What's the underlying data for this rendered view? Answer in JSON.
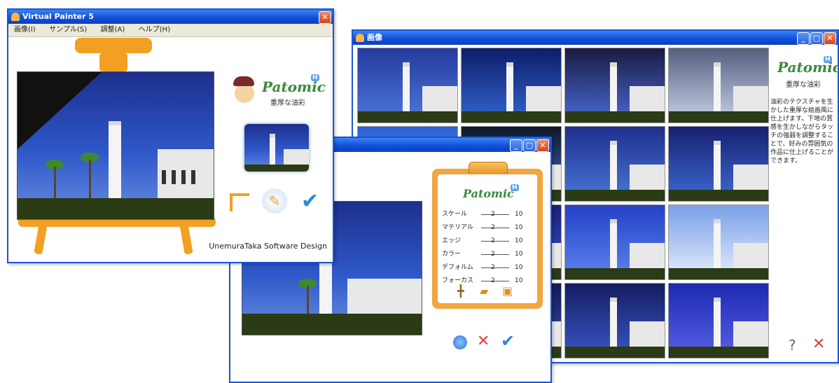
{
  "main_window": {
    "title": "Virtual Painter 5",
    "menu": [
      "画像(I)",
      "サンプル(S)",
      "調整(A)",
      "ヘルプ(H)"
    ],
    "logo_text": "Patomic",
    "logo_badge": "H",
    "logo_subtitle": "重厚な油彩",
    "credit": "UnemuraTaka Software Design"
  },
  "gallery_window": {
    "title": "画像",
    "logo_text": "Patomic",
    "logo_badge": "H",
    "logo_subtitle": "重厚な油彩",
    "description": "油彩のテクスチャを生かした重厚な絵画風に仕上げます。下地の質感を生かしながらタッチの強弱を調整することで、好みの雰囲気の作品に仕上げることができます。",
    "help_label": "?",
    "close_label": "✕"
  },
  "settings_window": {
    "logo_text": "Patomic",
    "logo_badge": "H",
    "params": [
      {
        "label": "スケール",
        "value": "2",
        "max": "10"
      },
      {
        "label": "マテリアル",
        "value": "2",
        "max": "10"
      },
      {
        "label": "エッジ",
        "value": "2",
        "max": "10"
      },
      {
        "label": "カラー",
        "value": "2",
        "max": "10"
      },
      {
        "label": "デフォルム",
        "value": "2",
        "max": "10"
      },
      {
        "label": "フォーカス",
        "value": "2",
        "max": "10"
      }
    ],
    "cancel_label": "✕",
    "ok_label": "✔"
  },
  "colors": {
    "titlebar": "#1350d8",
    "easel": "#f2a023",
    "accent_green": "#3a8a3a",
    "cancel_red": "#e04040",
    "ok_blue": "#2a8ad8"
  },
  "icons": [
    "window-icon",
    "minimize-icon",
    "maximize-icon",
    "close-icon",
    "easel-icon",
    "pen-hand-icon",
    "checkmark-icon",
    "add-icon",
    "folder-icon",
    "save-icon",
    "info-icon",
    "help-icon"
  ]
}
